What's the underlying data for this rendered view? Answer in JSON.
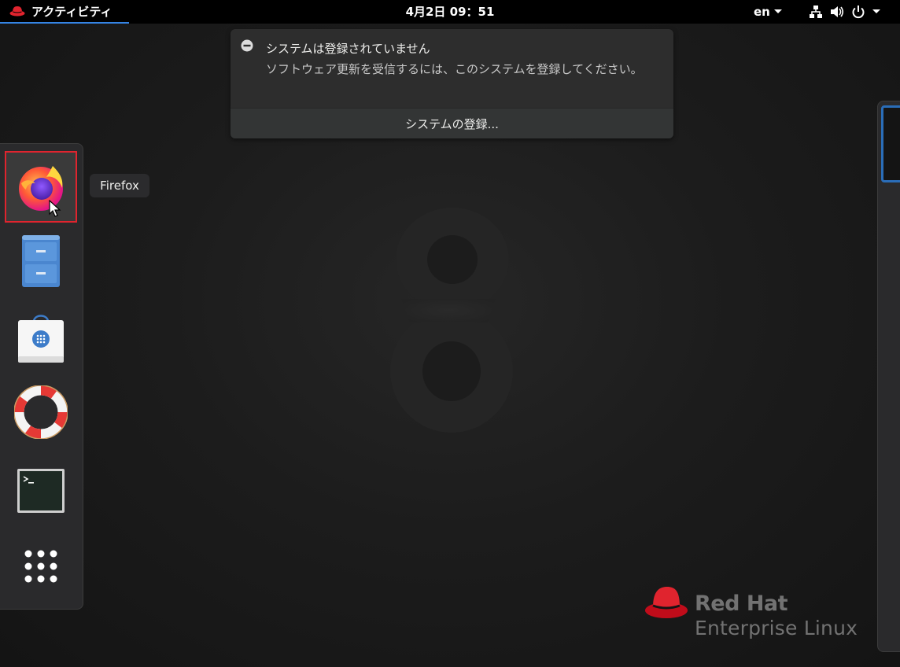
{
  "topbar": {
    "activities_label": "アクティビティ",
    "clock": "4月2日  09：51",
    "language": "en"
  },
  "notification": {
    "title": "システムは登録されていません",
    "message": "ソフトウェア更新を受信するには、このシステムを登録してください。",
    "action_label": "システムの登録..."
  },
  "dash": {
    "items": [
      {
        "name": "Firefox",
        "icon": "firefox-icon"
      },
      {
        "name": "Files",
        "icon": "file-cabinet-icon"
      },
      {
        "name": "Software",
        "icon": "software-bag-icon"
      },
      {
        "name": "Help",
        "icon": "lifebuoy-icon"
      },
      {
        "name": "Terminal",
        "icon": "terminal-icon"
      },
      {
        "name": "Show Applications",
        "icon": "app-grid-icon"
      }
    ],
    "tooltip": "Firefox"
  },
  "branding": {
    "brand_line1": "Red Hat",
    "brand_line2": "Enterprise Linux",
    "colors": {
      "accent": "#e0242e",
      "focus": "#3584e4"
    }
  }
}
